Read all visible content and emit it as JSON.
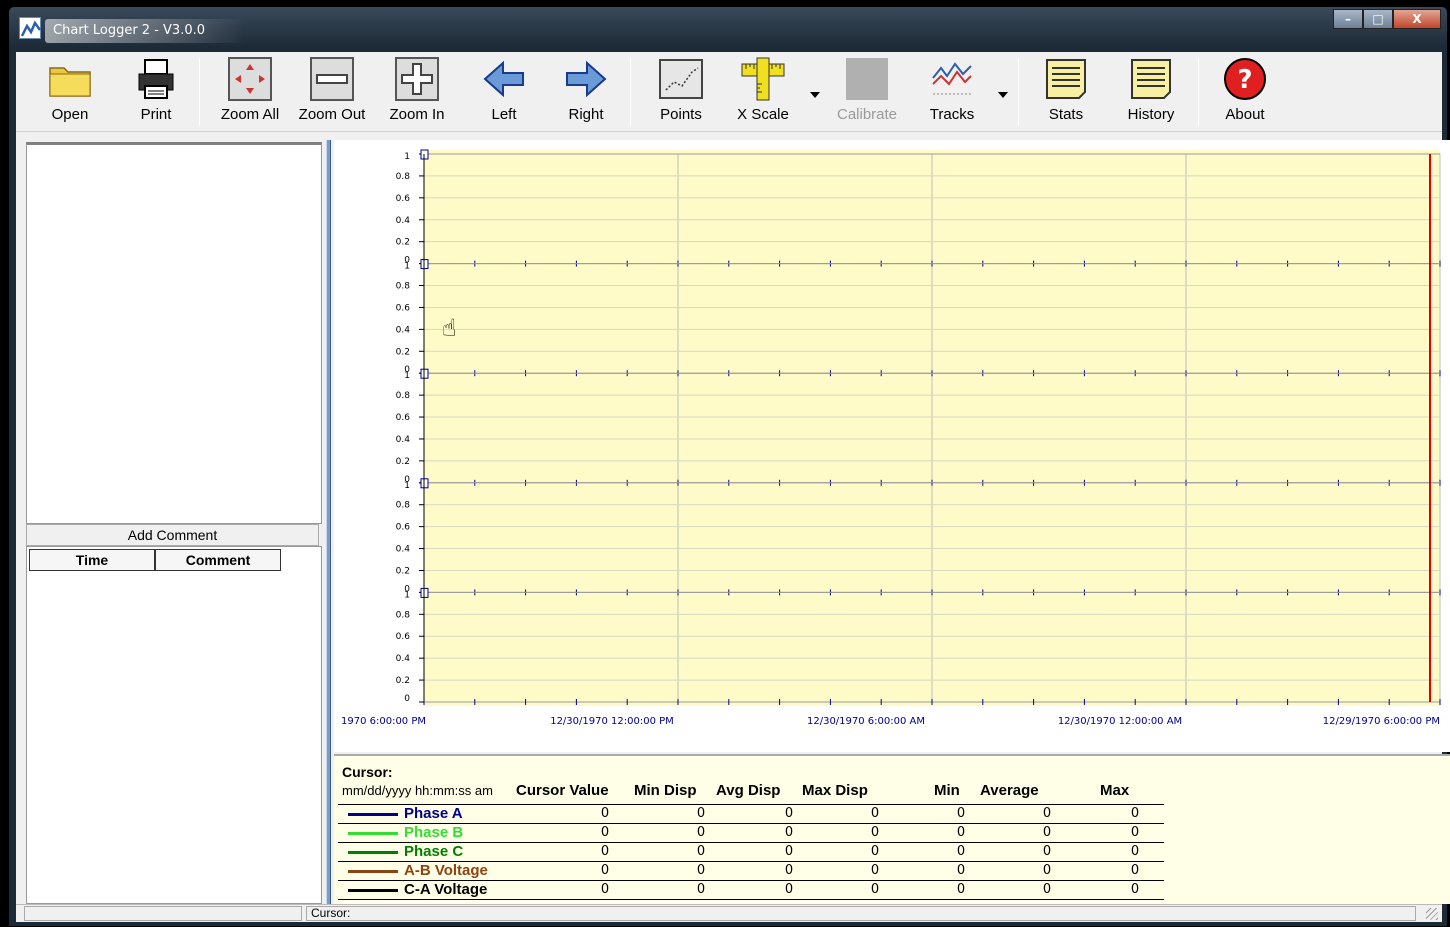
{
  "window": {
    "title": "Chart Logger 2 - V3.0.0",
    "minimize": "–",
    "maximize": "□",
    "close": "X"
  },
  "toolbar": {
    "open": "Open",
    "print": "Print",
    "zoom_all": "Zoom All",
    "zoom_out": "Zoom Out",
    "zoom_in": "Zoom In",
    "left": "Left",
    "right": "Right",
    "points": "Points",
    "x_scale": "X Scale",
    "calibrate": "Calibrate",
    "tracks": "Tracks",
    "stats": "Stats",
    "history": "History",
    "about": "About"
  },
  "comments": {
    "add_comment": "Add Comment",
    "col_time": "Time",
    "col_comment": "Comment"
  },
  "chart_data": {
    "type": "line",
    "tracks": 5,
    "ylim": [
      0,
      1
    ],
    "y_ticks": [
      "1",
      "0.8",
      "0.6",
      "0.4",
      "0.2",
      "0"
    ],
    "x_tick_labels": [
      "1970 6:00:00 PM",
      "12/30/1970 12:00:00 PM",
      "12/30/1970 6:00:00 AM",
      "12/30/1970 12:00:00 AM",
      "12/29/1970 6:00:00 PM"
    ],
    "background": "#fffbc8",
    "grid": true,
    "cursor_color": "#e00000"
  },
  "stats": {
    "cursor_label": "Cursor:",
    "date_format": "mm/dd/yyyy hh:mm:ss am",
    "headers": [
      "Cursor Value",
      "Min Disp",
      "Avg Disp",
      "Max Disp",
      "Min",
      "Average",
      "Max"
    ],
    "rows": [
      {
        "name": "Phase A",
        "color": "#00008b",
        "values": [
          "0",
          "0",
          "0",
          "0",
          "0",
          "0",
          "0"
        ]
      },
      {
        "name": "Phase B",
        "color": "#33dd33",
        "values": [
          "0",
          "0",
          "0",
          "0",
          "0",
          "0",
          "0"
        ]
      },
      {
        "name": "Phase C",
        "color": "#008000",
        "values": [
          "0",
          "0",
          "0",
          "0",
          "0",
          "0",
          "0"
        ]
      },
      {
        "name": "A-B Voltage",
        "color": "#8b4513",
        "values": [
          "0",
          "0",
          "0",
          "0",
          "0",
          "0",
          "0"
        ]
      },
      {
        "name": "C-A Voltage",
        "color": "#000000",
        "values": [
          "0",
          "0",
          "0",
          "0",
          "0",
          "0",
          "0"
        ]
      }
    ]
  },
  "status": {
    "cursor": "Cursor:"
  }
}
